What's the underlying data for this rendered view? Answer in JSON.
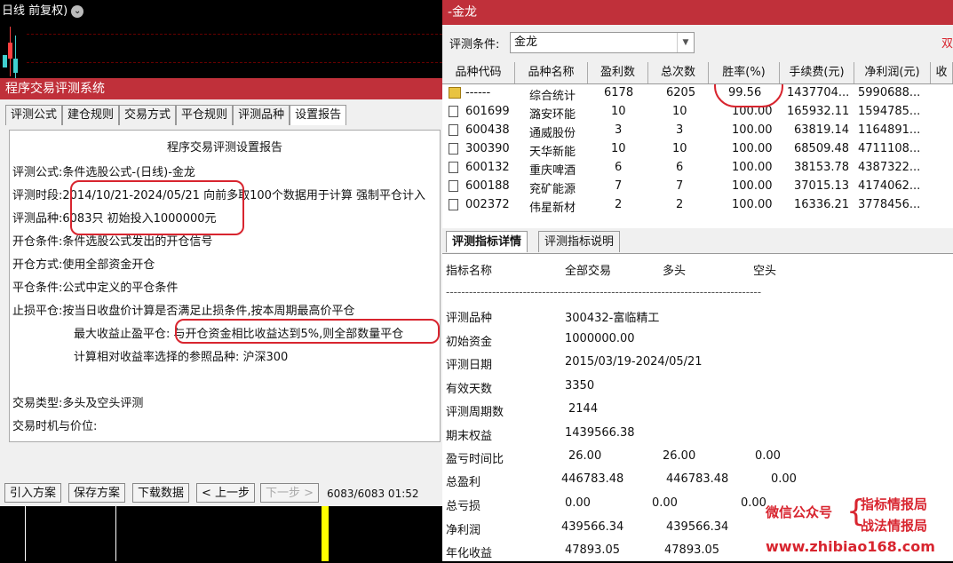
{
  "chart_header": {
    "title": "日线 前复权)"
  },
  "left_dialog": {
    "title": "程序交易评测系统",
    "tabs": [
      "评测公式",
      "建仓规则",
      "交易方式",
      "平仓规则",
      "评测品种",
      "设置报告"
    ],
    "report": {
      "heading": "程序交易评测设置报告",
      "rows": [
        {
          "label": "评测公式:",
          "value": "条件选股公式-(日线)-金龙"
        },
        {
          "label": "评测时段:",
          "value": "2014/10/21-2024/05/21 向前多取100个数据用于计算 强制平仓计入"
        },
        {
          "label": "评测品种:",
          "value": "6083只 初始投入1000000元"
        },
        {
          "label": "开仓条件:",
          "value": "条件选股公式发出的开仓信号"
        },
        {
          "label": "开仓方式:",
          "value": "使用全部资金开仓"
        },
        {
          "label": "平仓条件:",
          "value": "公式中定义的平仓条件"
        },
        {
          "label": "止损平仓:",
          "value": "按当日收盘价计算是否满足止损条件,按本周期最高价平仓"
        }
      ],
      "take_profit_label": "最大收益止盈平仓:",
      "take_profit_value": "与开仓资金相比收益达到5%,则全部数量平仓",
      "benchmark": "计算相对收益率选择的参照品种: 沪深300",
      "trade_type_label": "交易类型:",
      "trade_type_value": "多头及空头评测",
      "timing_label": "交易时机与价位:"
    },
    "buttons": {
      "import": "引入方案",
      "save": "保存方案",
      "download": "下载数据",
      "prev": "< 上一步",
      "next": "下一步 >"
    },
    "progress": "6083/6083 01:52"
  },
  "right_panel": {
    "title": "-金龙",
    "condition_label": "评测条件:",
    "condition_value": "金龙",
    "condition_red": "双",
    "columns": [
      "品种代码",
      "品种名称",
      "盈利数",
      "总次数",
      "胜率(%)",
      "手续费(元)",
      "净利润(元)",
      "收"
    ],
    "rows": [
      {
        "code": "------",
        "name": "综合统计",
        "wins": "6178",
        "total": "6205",
        "rate": "99.56",
        "fee": "1437704...",
        "net": "5990688..."
      },
      {
        "code": "601699",
        "name": "潞安环能",
        "wins": "10",
        "total": "10",
        "rate": "100.00",
        "fee": "165932.11",
        "net": "1594785..."
      },
      {
        "code": "600438",
        "name": "通威股份",
        "wins": "3",
        "total": "3",
        "rate": "100.00",
        "fee": "63819.14",
        "net": "1164891..."
      },
      {
        "code": "300390",
        "name": "天华新能",
        "wins": "10",
        "total": "10",
        "rate": "100.00",
        "fee": "68509.48",
        "net": "4711108..."
      },
      {
        "code": "600132",
        "name": "重庆啤酒",
        "wins": "6",
        "total": "6",
        "rate": "100.00",
        "fee": "38153.78",
        "net": "4387322..."
      },
      {
        "code": "600188",
        "name": "兖矿能源",
        "wins": "7",
        "total": "7",
        "rate": "100.00",
        "fee": "37015.13",
        "net": "4174062..."
      },
      {
        "code": "002372",
        "name": "伟星新材",
        "wins": "2",
        "total": "2",
        "rate": "100.00",
        "fee": "16336.21",
        "net": "3778456..."
      }
    ],
    "detail_tabs": [
      "评测指标详情",
      "评测指标说明"
    ],
    "detail_header": [
      "指标名称",
      "全部交易",
      "多头",
      "空头"
    ],
    "detail_dashes": "----------------------------------------------------------------------------------",
    "detail_rows": [
      {
        "name": "评测品种",
        "all": "300432-富临精工",
        "long": "",
        "short": ""
      },
      {
        "name": "初始资金",
        "all": "1000000.00",
        "long": "",
        "short": ""
      },
      {
        "name": "评测日期",
        "all": "2015/03/19-2024/05/21",
        "long": "",
        "short": ""
      },
      {
        "name": "有效天数",
        "all": "3350",
        "long": "",
        "short": ""
      },
      {
        "name": "评测周期数",
        "all": "2144",
        "long": "",
        "short": ""
      },
      {
        "name": "期末权益",
        "all": "1439566.38",
        "long": "",
        "short": ""
      },
      {
        "name": "盈亏时间比",
        "all": "26.00",
        "long": "26.00",
        "short": "0.00"
      },
      {
        "name": "总盈利",
        "all": "446783.48",
        "long": "446783.48",
        "short": "0.00"
      },
      {
        "name": "总亏损",
        "all": "0.00",
        "long": "0.00",
        "short": "0.00"
      },
      {
        "name": "净利润",
        "all": "439566.34",
        "long": "439566.34",
        "short": "0.00"
      },
      {
        "name": "年化收益",
        "all": "47893.05",
        "long": "47893.05",
        "short": "0.00"
      }
    ]
  },
  "watermark": {
    "wechat": "微信公众号",
    "brand1": "指标情报局",
    "brand2": "战法情报局",
    "url": "www.zhibiao168.com"
  },
  "colors": {
    "titlebar": "#c0303a",
    "highlight_circle": "#d8252f",
    "candle_up": "#ff4040",
    "candle_down": "#40d0d0",
    "marker": "#ffff00"
  }
}
